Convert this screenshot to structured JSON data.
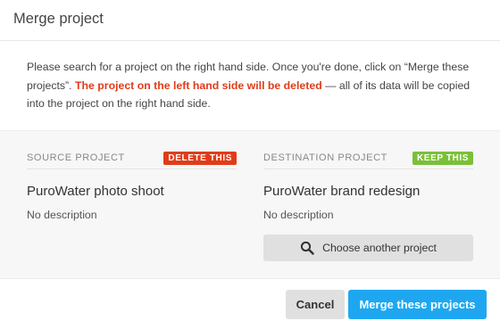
{
  "dialog": {
    "title": "Merge project"
  },
  "intro": {
    "text_before": "Please search for a project on the right hand side. Once you're done, click on “Merge these projects”. ",
    "warning": "The project on the left hand side will be deleted",
    "text_after": " — all of its data will be copied into the project on the right hand side."
  },
  "source": {
    "label": "SOURCE PROJECT",
    "tag": "DELETE THIS",
    "name": "PuroWater photo shoot",
    "description": "No description"
  },
  "destination": {
    "label": "DESTINATION PROJECT",
    "tag": "KEEP THIS",
    "name": "PuroWater brand redesign",
    "description": "No description",
    "choose_label": "Choose another project",
    "choose_icon": "search-icon"
  },
  "footer": {
    "cancel_label": "Cancel",
    "merge_label": "Merge these projects"
  },
  "colors": {
    "danger": "#e03c1a",
    "success": "#7cbf3a",
    "primary": "#1ea7f0",
    "panel": "#f7f7f7"
  }
}
